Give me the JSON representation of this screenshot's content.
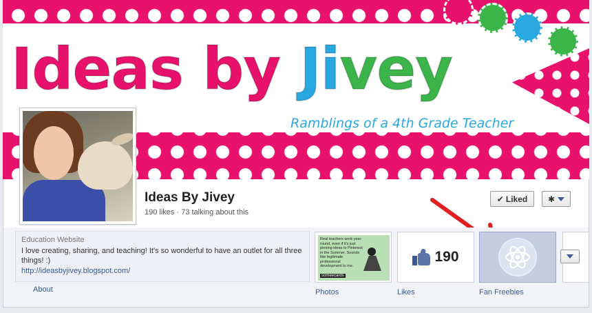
{
  "cover": {
    "title_parts": [
      "Ideas ",
      "by ",
      "Ji",
      "vey"
    ],
    "subtitle": "Ramblings of a 4th Grade Teacher"
  },
  "profile": {
    "name": "Ideas By Jivey",
    "stats": "190 likes · 73 talking about this"
  },
  "actions": {
    "liked_label": "Liked"
  },
  "about": {
    "category": "Education Website",
    "description": "I love creating, sharing, and teaching! It's so wonderful to have an outlet for all three things! :)",
    "url": "http://ideasbyjivey.blogspot.com/",
    "about_label": "About"
  },
  "tiles": {
    "photos_label": "Photos",
    "photo_card_text": "Real teachers work year-round, even if it's just pinning ideas to Pinterest in the Summer. Sounds like legitimate professional development to me.",
    "photo_card_brand": "someecards",
    "likes_label": "Likes",
    "likes_count": "190",
    "fan_label": "Fan Freebies"
  },
  "colors": {
    "accent_pink": "#e8126c",
    "accent_green": "#3bb54a",
    "accent_blue": "#29a8e0",
    "link_blue": "#3b5998",
    "arrow_red": "#e02020"
  },
  "icons": [
    "check-icon",
    "gear-icon",
    "chevron-down-icon",
    "thumbs-up-icon",
    "atom-icon",
    "arrow-annotation"
  ]
}
